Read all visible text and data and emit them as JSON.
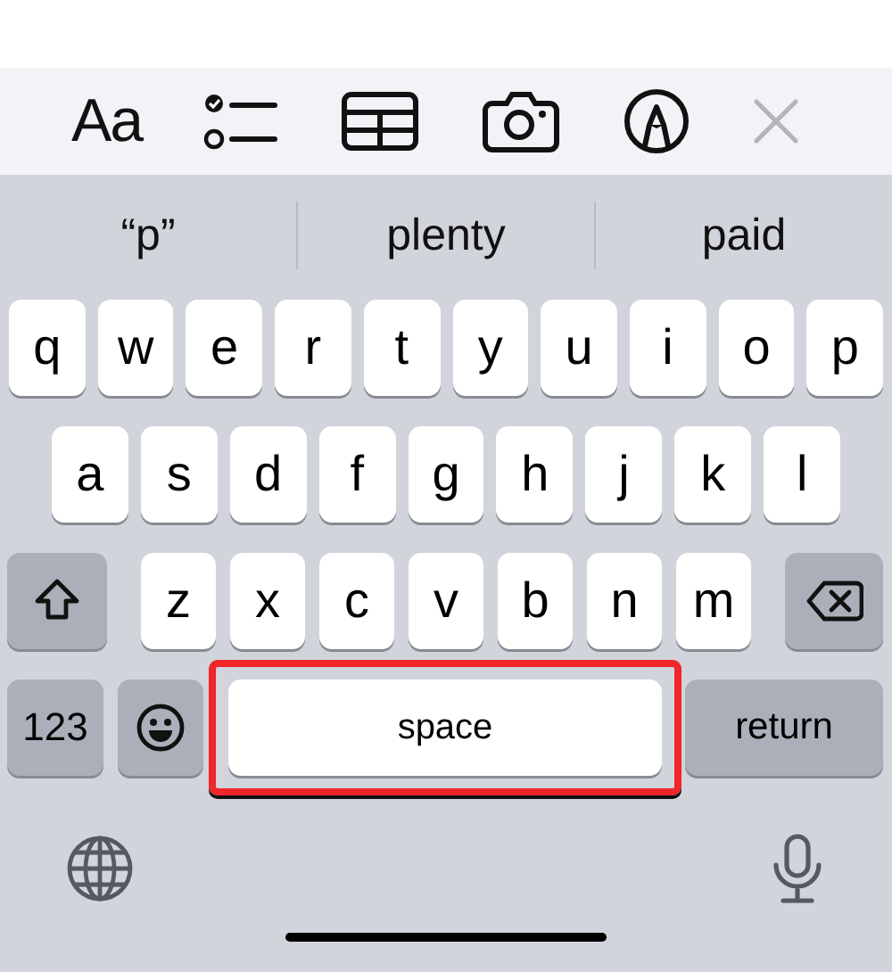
{
  "toolbar": [
    {
      "kind": "format",
      "label": "Aa",
      "disabled": false
    },
    {
      "kind": "checklist",
      "disabled": false
    },
    {
      "kind": "table",
      "disabled": false
    },
    {
      "kind": "camera",
      "disabled": false
    },
    {
      "kind": "markup",
      "disabled": false
    },
    {
      "kind": "close",
      "disabled": true
    }
  ],
  "suggestions": [
    "“p”",
    "plenty",
    "paid"
  ],
  "letter_rows": [
    [
      "q",
      "w",
      "e",
      "r",
      "t",
      "y",
      "u",
      "i",
      "o",
      "p"
    ],
    [
      "a",
      "s",
      "d",
      "f",
      "g",
      "h",
      "j",
      "k",
      "l"
    ],
    [
      "z",
      "x",
      "c",
      "v",
      "b",
      "n",
      "m"
    ]
  ],
  "bottom_row": [
    {
      "kind": "numbers",
      "label": "123"
    },
    {
      "kind": "emoji"
    },
    {
      "kind": "space",
      "label": "space",
      "highlighted": true
    },
    {
      "kind": "return",
      "label": "return"
    }
  ],
  "footer": [
    {
      "kind": "globe"
    },
    {
      "kind": "dictation"
    }
  ]
}
